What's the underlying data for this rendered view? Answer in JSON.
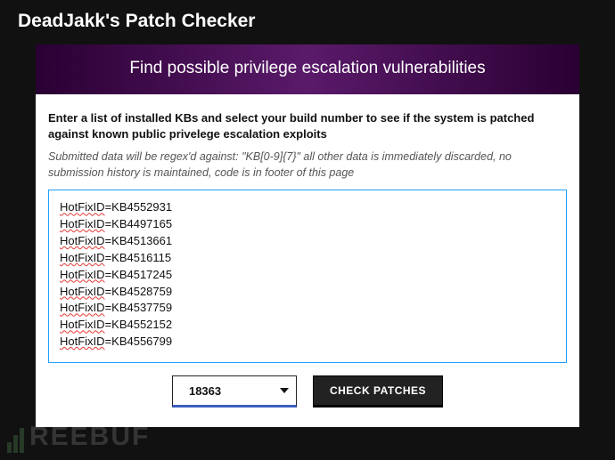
{
  "brand": "DeadJakk's Patch Checker",
  "hero": {
    "title": "Find possible privilege escalation vulnerabilities"
  },
  "form": {
    "instructions": "Enter a list of installed KBs and select your build number to see if the system is patched against known public privelege escalation exploits",
    "disclaimer": "Submitted data will be regex'd against: \"KB[0-9]{7}\" all other data is immediately discarded, no submission history is maintained, code is in footer of this page",
    "kb_entries": [
      {
        "prefix": "HotFixID",
        "value": "=KB4552931"
      },
      {
        "prefix": "HotFixID",
        "value": "=KB4497165"
      },
      {
        "prefix": "HotFixID",
        "value": "=KB4513661"
      },
      {
        "prefix": "HotFixID",
        "value": "=KB4516115"
      },
      {
        "prefix": "HotFixID",
        "value": "=KB4517245"
      },
      {
        "prefix": "HotFixID",
        "value": "=KB4528759"
      },
      {
        "prefix": "HotFixID",
        "value": "=KB4537759"
      },
      {
        "prefix": "HotFixID",
        "value": "=KB4552152"
      },
      {
        "prefix": "HotFixID",
        "value": "=KB4556799"
      }
    ],
    "build_selected": "18363",
    "check_label": "CHECK PATCHES"
  },
  "watermark": "REEBUF"
}
